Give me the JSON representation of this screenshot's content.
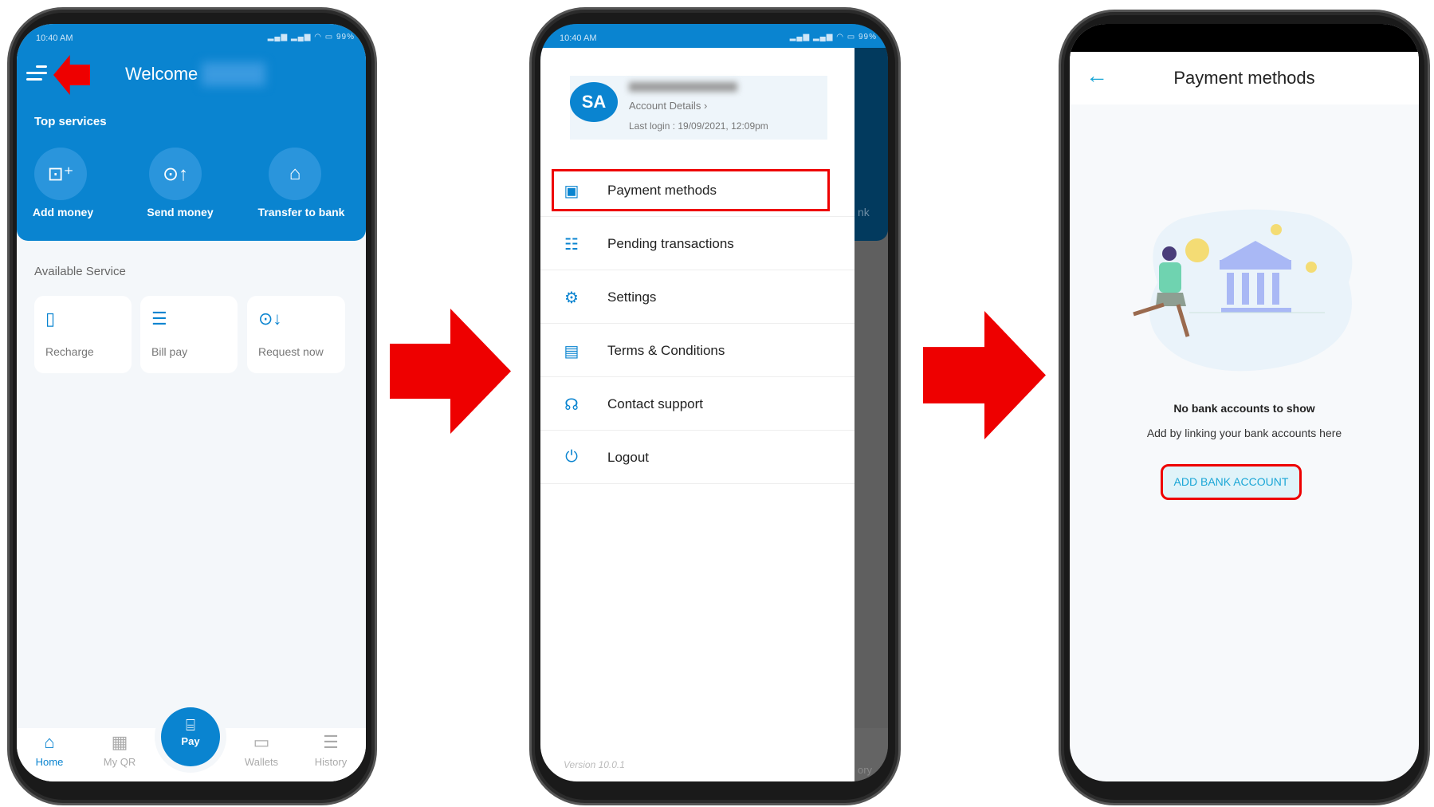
{
  "colors": {
    "primary": "#0a84d0",
    "highlight": "#e00000",
    "accent_teal": "#1aa6d6"
  },
  "screen1": {
    "status": {
      "time": "10:40 AM",
      "battery": "99%"
    },
    "header": {
      "welcome": "Welcome"
    },
    "top_services": {
      "title": "Top services",
      "items": [
        {
          "label": "Add money",
          "icon": "wallet-plus-icon"
        },
        {
          "label": "Send money",
          "icon": "money-send-icon"
        },
        {
          "label": "Transfer to bank",
          "icon": "bank-transfer-icon"
        }
      ]
    },
    "available": {
      "title": "Available Service",
      "items": [
        {
          "label": "Recharge",
          "icon": "mobile-recharge-icon"
        },
        {
          "label": "Bill pay",
          "icon": "bill-icon"
        },
        {
          "label": "Request now",
          "icon": "money-request-icon"
        }
      ]
    },
    "nav": {
      "items": [
        {
          "label": "Home",
          "icon": "home-icon",
          "active": true
        },
        {
          "label": "My QR",
          "icon": "qr-icon"
        },
        {
          "label": "Wallets",
          "icon": "wallet-icon"
        },
        {
          "label": "History",
          "icon": "history-icon"
        }
      ],
      "pay": "Pay"
    }
  },
  "screen2": {
    "status": {
      "time": "10:40 AM",
      "battery": "99%"
    },
    "profile": {
      "initials": "SA",
      "account_details": "Account Details",
      "last_login": "Last login : 19/09/2021, 12:09pm"
    },
    "menu": [
      {
        "label": "Payment methods",
        "icon": "payment-card-icon",
        "highlighted": true
      },
      {
        "label": "Pending transactions",
        "icon": "pending-list-icon"
      },
      {
        "label": "Settings",
        "icon": "gear-icon"
      },
      {
        "label": "Terms & Conditions",
        "icon": "document-icon"
      },
      {
        "label": "Contact support",
        "icon": "support-headset-icon"
      },
      {
        "label": "Logout",
        "icon": "power-icon"
      }
    ],
    "version": "Version 10.0.1",
    "behind": {
      "partial_label": "nk",
      "partial_nav": "ory"
    }
  },
  "screen3": {
    "title": "Payment methods",
    "empty_title": "No bank accounts to show",
    "empty_sub": "Add by linking your bank accounts here",
    "add_button": "ADD BANK ACCOUNT"
  }
}
